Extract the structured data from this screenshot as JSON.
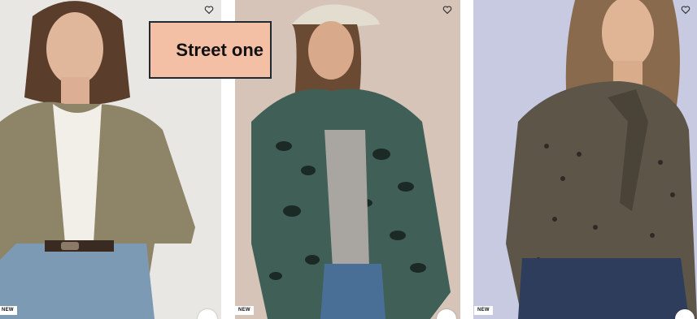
{
  "products": [
    {
      "badge": "NEW",
      "wishlist_icon": "heart-outline-icon",
      "image": "woman-olive-cardigan"
    },
    {
      "badge": "NEW",
      "wishlist_icon": "heart-outline-icon",
      "image": "woman-leopard-fleece-jacket"
    },
    {
      "badge": "NEW",
      "wishlist_icon": "heart-outline-icon",
      "image": "woman-leopard-bow-blouse"
    }
  ],
  "brand": {
    "label": "Street one"
  },
  "colors": {
    "brand_box": "#f3c0a6",
    "badge_bg": "#ffffff"
  }
}
